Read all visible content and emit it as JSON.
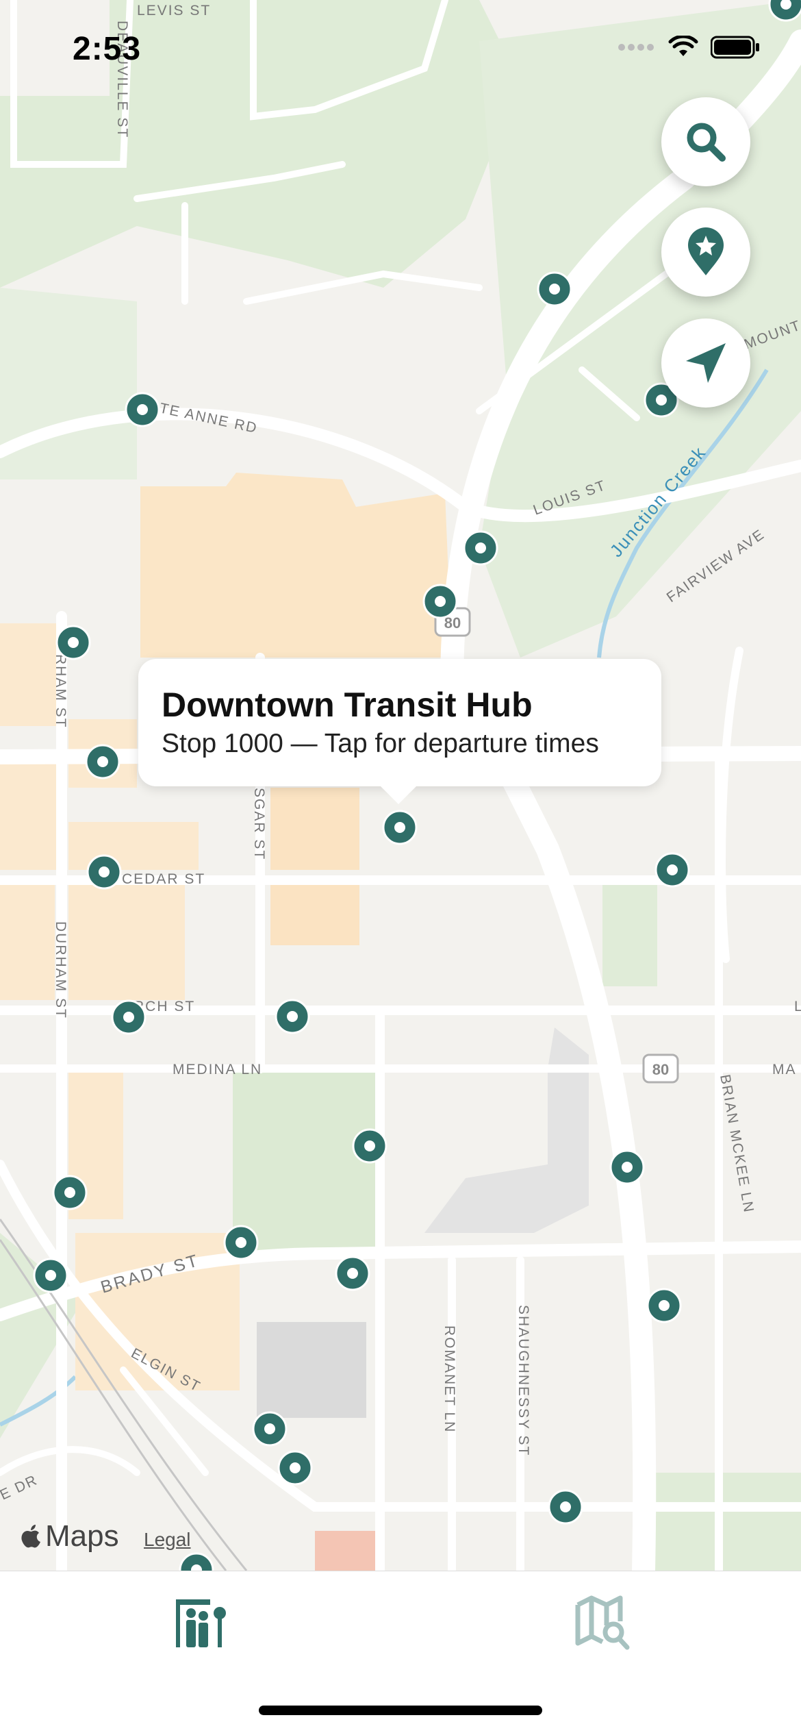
{
  "status_bar": {
    "time": "2:53"
  },
  "callout": {
    "title": "Downtown Transit Hub",
    "subtitle": "Stop 1000  —  Tap for departure times"
  },
  "map_buttons": [
    {
      "name": "search-button",
      "icon": "search-icon"
    },
    {
      "name": "favorites-button",
      "icon": "star-pin-icon"
    },
    {
      "name": "locate-button",
      "icon": "location-arrow-icon"
    }
  ],
  "map": {
    "brand": "Maps",
    "legal": "Legal",
    "labels": {
      "levis": "LEVIS ST",
      "deauville": "DEAUVILLE ST",
      "sainte_anne": "TE ANNE RD",
      "louis": "LOUIS ST",
      "junction_creek": "Junction Creek",
      "fairview": "FAIRVIEW AVE",
      "mount": "MOUNT",
      "hwy80": "80",
      "durham_top": "RHAM ST",
      "durham": "DURHAM ST",
      "elgar": "SGAR ST",
      "cedar": "CEDAR ST",
      "birch": "RCH ST",
      "medina": "MEDINA LN",
      "brady": "BRADY ST",
      "elgin": "ELGIN ST",
      "romanet": "ROMANET LN",
      "shaughnessy": "SHAUGHNESSY ST",
      "brian_mckee": "BRIAN MCKEE LN",
      "ma": "MA",
      "l": "L",
      "e_dr": "E DR"
    },
    "accent_color": "#2f6e68"
  },
  "tabs": [
    {
      "name": "tab-stops",
      "icon": "bus-stop-icon",
      "active": true
    },
    {
      "name": "tab-map-search",
      "icon": "map-search-icon",
      "active": false
    }
  ]
}
